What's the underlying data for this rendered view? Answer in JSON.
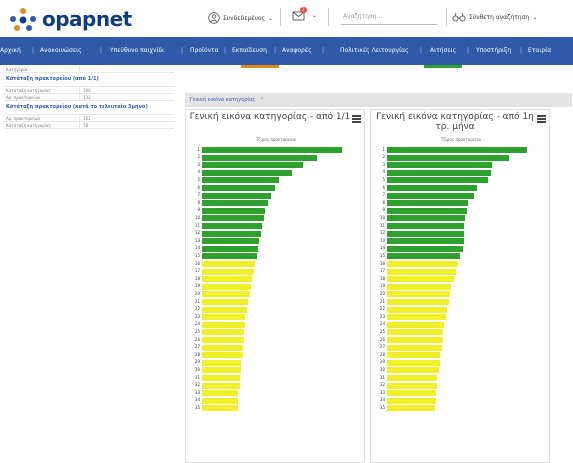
{
  "header": {
    "logo_text": "opapnet",
    "user_label": "Συνδεδεμένος",
    "notification_count": "2",
    "search_placeholder": "Αναζήτηση...",
    "advanced_search_label": "Σύνθετη αναζήτηση",
    "brand_color": "#123c7a",
    "accent_color": "#e28a1e"
  },
  "nav": {
    "items": [
      "Αρχική",
      "Ανακοινώσεις",
      "Υπεύθυνο παιχνίδι",
      "Προϊόντα",
      "Εκπαίδευση",
      "Αναφορές",
      "Πολιτικές Λειτουργίας",
      "Αιτήσεις",
      "Υποστήριξη",
      "Εταιρία"
    ],
    "background": "#2e5aa8"
  },
  "left_panel": {
    "top_row_label": "Κατηγορία",
    "sections": [
      {
        "title": "Κατάταξη πρακτορείου (από 1/1)",
        "rows": [
          {
            "key": "Κατάταξη κατηγορίας",
            "value": "196"
          },
          {
            "key": "Αρ. πρακτορείων",
            "value": "132"
          }
        ]
      },
      {
        "title": "Κατάταξη πρακτορείου (κατά το τελευταίο 3μηνο)",
        "rows": [
          {
            "key": "Αρ. πρακτορείων",
            "value": "161"
          },
          {
            "key": "Κατάταξη κατηγορίας",
            "value": "78"
          }
        ]
      }
    ]
  },
  "right_panel": {
    "title": "Γενική εικόνα κατηγορίας",
    "charts": [
      {
        "title": "Γενική εικόνα κατηγορίας - από 1/1",
        "subtitle": "Τζίρος πρακτορείου",
        "chart_data": {
          "type": "bar",
          "orientation": "horizontal",
          "categories": [
            "1",
            "2",
            "3",
            "4",
            "5",
            "6",
            "7",
            "8",
            "9",
            "10",
            "11",
            "12",
            "13",
            "14",
            "15",
            "16",
            "17",
            "18",
            "19",
            "20",
            "21",
            "22",
            "23",
            "24",
            "25",
            "26",
            "27",
            "28",
            "29",
            "30",
            "31",
            "32",
            "33",
            "34",
            "35"
          ],
          "values": [
            100,
            82,
            72,
            64,
            55,
            52,
            49,
            47,
            45,
            44,
            43,
            42,
            41,
            40,
            39,
            38,
            37,
            36,
            35,
            34,
            33,
            32,
            31,
            31,
            30,
            30,
            29,
            29,
            28,
            28,
            27,
            27,
            26,
            26,
            26
          ],
          "colors": {
            "top": "#2ea02e",
            "rest": "#f0f02a"
          },
          "green_count": 15
        }
      },
      {
        "title": "Γενική εικόνα κατηγορίας - από 1η τρ. μήνα",
        "subtitle": "Τζίρος πρακτορείου",
        "chart_data": {
          "type": "bar",
          "orientation": "horizontal",
          "categories": [
            "1",
            "2",
            "3",
            "4",
            "5",
            "6",
            "7",
            "8",
            "9",
            "10",
            "11",
            "12",
            "13",
            "14",
            "15",
            "16",
            "17",
            "18",
            "19",
            "20",
            "21",
            "22",
            "23",
            "24",
            "25",
            "26",
            "27",
            "28",
            "29",
            "30",
            "31",
            "32",
            "33",
            "34",
            "35"
          ],
          "values": [
            100,
            87,
            75,
            74,
            72,
            64,
            62,
            58,
            57,
            56,
            55,
            55,
            55,
            54,
            52,
            51,
            49,
            48,
            46,
            45,
            44,
            43,
            42,
            41,
            40,
            40,
            39,
            38,
            38,
            37,
            36,
            36,
            35,
            35,
            34
          ],
          "colors": {
            "top": "#2ea02e",
            "rest": "#f0f02a"
          },
          "green_count": 15
        }
      }
    ]
  }
}
